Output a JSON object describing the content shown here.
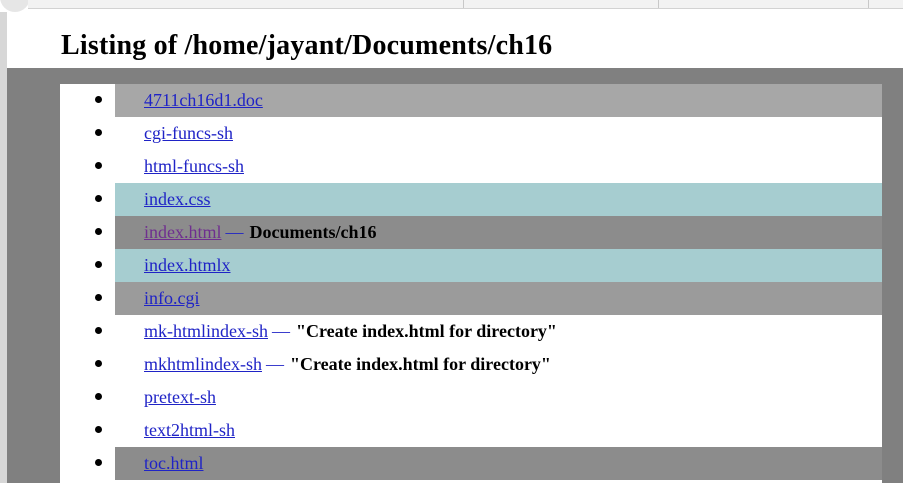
{
  "page": {
    "title": "Listing of /home/jayant/Documents/ch16"
  },
  "listing": {
    "items": [
      {
        "name": "4711ch16d1.doc",
        "separator": "",
        "description": "",
        "shade": "gray",
        "visited": false
      },
      {
        "name": "cgi-funcs-sh",
        "separator": "",
        "description": "",
        "shade": "white",
        "visited": false
      },
      {
        "name": "html-funcs-sh",
        "separator": "",
        "description": "",
        "shade": "white",
        "visited": false
      },
      {
        "name": "index.css",
        "separator": "",
        "description": "",
        "shade": "teal",
        "visited": false
      },
      {
        "name": "index.html",
        "separator": "—",
        "description": "Documents/ch16",
        "shade": "dark",
        "visited": true
      },
      {
        "name": "index.htmlx",
        "separator": "",
        "description": "",
        "shade": "teal",
        "visited": false
      },
      {
        "name": "info.cgi",
        "separator": "",
        "description": "",
        "shade": "mid",
        "visited": false
      },
      {
        "name": "mk-htmlindex-sh",
        "separator": "—",
        "description": "\"Create index.html for directory\"",
        "shade": "white",
        "visited": false
      },
      {
        "name": "mkhtmlindex-sh",
        "separator": "—",
        "description": "\"Create index.html for directory\"",
        "shade": "white",
        "visited": false
      },
      {
        "name": "pretext-sh",
        "separator": "",
        "description": "",
        "shade": "white",
        "visited": false
      },
      {
        "name": "text2html-sh",
        "separator": "",
        "description": "",
        "shade": "white",
        "visited": false
      },
      {
        "name": "toc.html",
        "separator": "",
        "description": "",
        "shade": "dark",
        "visited": false
      }
    ]
  },
  "colors": {
    "link": "#1f23c6",
    "visited_link": "#6f2f8f",
    "gray_background": "#808080",
    "row_gray": "#a7a7a7",
    "row_teal": "#a6cdd0",
    "row_dark": "#8c8c8c"
  },
  "icons": {
    "bullet": "bullet-icon"
  }
}
